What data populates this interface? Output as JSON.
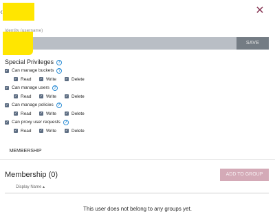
{
  "header": {
    "back_glyph": "‹",
    "close_glyph": "✕"
  },
  "identity": {
    "field_label": "Identity (username)",
    "value": "",
    "save_label": "SAVE"
  },
  "privileges": {
    "title": "Special Privileges",
    "help_glyph": "?",
    "items": [
      {
        "label": "Can manage buckets",
        "checked": true,
        "subs": [
          "Read",
          "Write",
          "Delete"
        ]
      },
      {
        "label": "Can manage users",
        "checked": true,
        "subs": [
          "Read",
          "Write",
          "Delete"
        ]
      },
      {
        "label": "Can manage policies",
        "checked": true,
        "subs": [
          "Read",
          "Write",
          "Delete"
        ]
      },
      {
        "label": "Can proxy user requests",
        "checked": true,
        "subs": [
          "Read",
          "Write",
          "Delete"
        ]
      }
    ]
  },
  "tabs": {
    "membership_label": "MEMBERSHIP"
  },
  "membership": {
    "title": "Membership (0)",
    "add_label": "ADD TO GROUP",
    "column_header": "Display Name ▴",
    "empty_message": "This user does not belong to any groups yet."
  },
  "colors": {
    "accent": "#8a3a58",
    "help": "#2f8fd6",
    "checkbox": "#5d6d82",
    "save_bg": "#747c84",
    "add_bg": "#d4aab7",
    "redaction": "#ffe600"
  }
}
